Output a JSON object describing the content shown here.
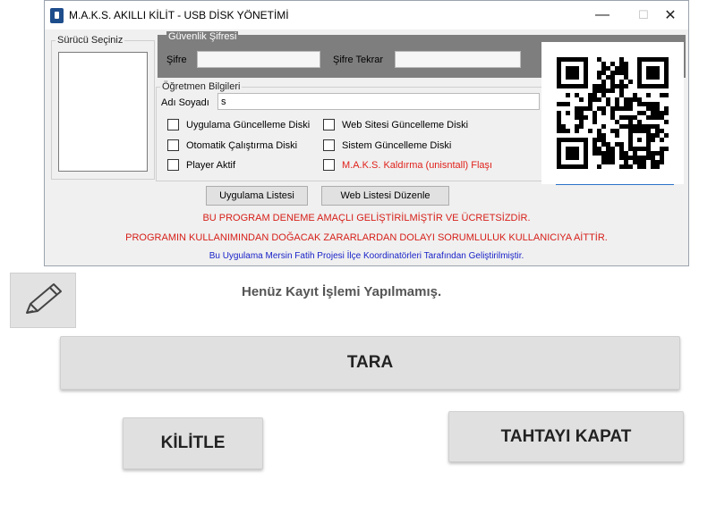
{
  "window": {
    "title": "M.A.K.S. AKILLI KİLİT -  USB DİSK YÖNETİMİ",
    "minimize": "—",
    "maximize": "☐",
    "close": "✕"
  },
  "drive_group": {
    "legend": "Sürücü Seçiniz"
  },
  "security": {
    "legend": "Güvenlik Şifresi",
    "password_label": "Şifre",
    "password_value": "",
    "repeat_label": "Şifre Tekrar",
    "repeat_value": ""
  },
  "teacher": {
    "legend": "Öğretmen Bilgileri",
    "name_label": "Adı Soyadı",
    "name_value": "s"
  },
  "options": [
    {
      "label": "Uygulama Güncelleme Diski",
      "checked": false,
      "color": "#000000"
    },
    {
      "label": "Web Sitesi Güncelleme Diski",
      "checked": false,
      "color": "#000000"
    },
    {
      "label": "Otomatik Çalıştırma Diski",
      "checked": false,
      "color": "#000000"
    },
    {
      "label": "Sistem Güncelleme Diski",
      "checked": false,
      "color": "#000000"
    },
    {
      "label": "Player Aktif",
      "checked": false,
      "color": "#000000"
    },
    {
      "label": "M.A.K.S. Kaldırma (unisntall) Flaşı",
      "checked": false,
      "color": "#e0211b"
    }
  ],
  "buttons": {
    "app_list": "Uygulama Listesi",
    "web_list": "Web Listesi Düzenle"
  },
  "messages": {
    "line1": "BU PROGRAM DENEME AMAÇLI GELİŞTİRİLMİŞTİR VE ÜCRETSİZDİR.",
    "line2": "PROGRAMIN KULLANIMINDAN DOĞACAK ZARARLARDAN DOLAYI SORUMLULUK KULLANICIYA AİTTİR.",
    "line3": "Bu Uygulama Mersin Fatih Projesi İlçe Koordinatörleri Tarafından Geliştirilmiştir.",
    "red": "#d6201a",
    "blue": "#1a23c8"
  },
  "lower": {
    "status": "Henüz Kayıt İşlemi Yapılmamış.",
    "scan": "TARA",
    "lock": "KİLİTLE",
    "close_board": "TAHTAYI KAPAT",
    "edit_icon": "pencil-icon"
  }
}
